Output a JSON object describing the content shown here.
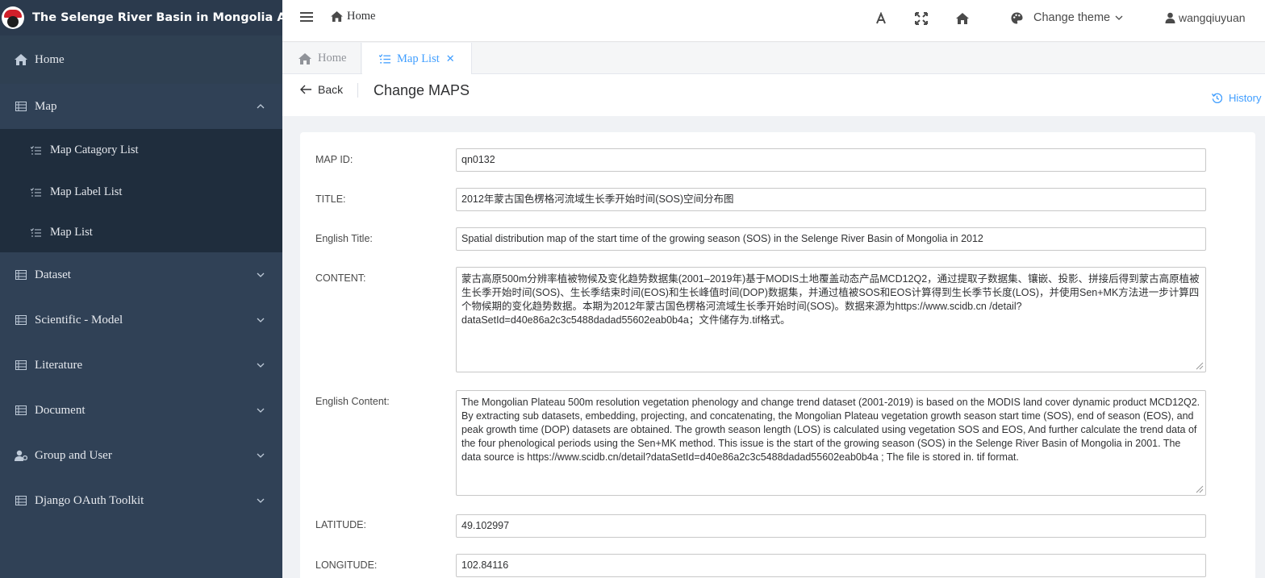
{
  "brand": {
    "title": "The Selenge River Basin in Mongolia Admin"
  },
  "sidebar": {
    "home": "Home",
    "map": {
      "label": "Map",
      "children": [
        "Map Catagory List",
        "Map Label List",
        "Map List"
      ]
    },
    "items": [
      "Dataset",
      "Scientific - Model",
      "Literature",
      "Document",
      "Group and User",
      "Django OAuth Toolkit"
    ]
  },
  "header": {
    "breadcrumb": "Home",
    "theme_label": "Change theme",
    "username": "wangqiuyuan"
  },
  "tabs": {
    "home": "Home",
    "active": "Map List"
  },
  "page": {
    "back": "Back",
    "title": "Change MAPS",
    "history": "History"
  },
  "form": {
    "map_id": {
      "label": "MAP ID:",
      "value": "qn0132"
    },
    "title": {
      "label": "TITLE:",
      "value": "2012年蒙古国色楞格河流域生长季开始时间(SOS)空间分布图"
    },
    "english_title": {
      "label": "English Title:",
      "value": "Spatial distribution map of the start time of the growing season (SOS) in the Selenge River Basin of Mongolia in 2012"
    },
    "content": {
      "label": "CONTENT:",
      "value": "蒙古高原500m分辨率植被物候及变化趋势数据集(2001–2019年)基于MODIS土地覆盖动态产品MCD12Q2，通过提取子数据集、镶嵌、投影、拼接后得到蒙古高原植被生长季开始时间(SOS)、生长季结束时间(EOS)和生长峰值时间(DOP)数据集，并通过植被SOS和EOS计算得到生长季节长度(LOS)，并使用Sen+MK方法进一步计算四个物候期的变化趋势数据。本期为2012年蒙古国色楞格河流域生长季开始时间(SOS)。数据来源为https://www.scidb.cn /detail?dataSetId=d40e86a2c3c5488dadad55602eab0b4a；文件储存为.tif格式。"
    },
    "english_content": {
      "label": "English Content:",
      "value": "The Mongolian Plateau 500m resolution vegetation phenology and change trend dataset (2001-2019) is based on the MODIS land cover dynamic product MCD12Q2. By extracting sub datasets, embedding, projecting, and concatenating, the Mongolian Plateau vegetation growth season start time (SOS), end of season (EOS), and peak growth time (DOP) datasets are obtained. The growth season length (LOS) is calculated using vegetation SOS and EOS, And further calculate the trend data of the four phenological periods using the Sen+MK method. This issue is the start of the growing season (SOS) in the Selenge River Basin of Mongolia in 2001. The data source is https://www.scidb.cn/detail?dataSetId=d40e86a2c3c5488dadad55602eab0b4a ; The file is stored in. tif format."
    },
    "latitude": {
      "label": "LATITUDE:",
      "value": "49.102997"
    },
    "longitude": {
      "label": "LONGITUDE:",
      "value": "102.84116"
    }
  },
  "colors": {
    "sidebar_bg": "#304156",
    "submenu_bg": "#1f2d3d",
    "accent": "#409eff"
  }
}
